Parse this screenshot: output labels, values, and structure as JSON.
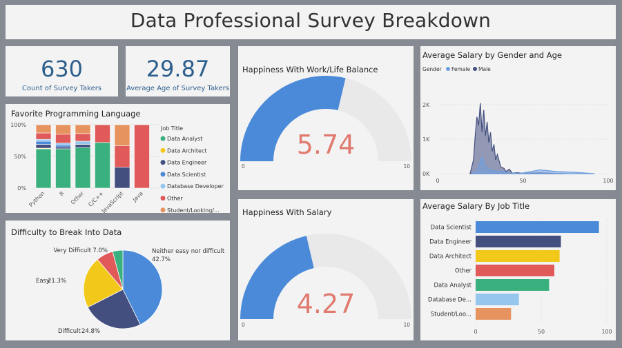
{
  "title": "Data Professional Survey Breakdown",
  "kpis": [
    {
      "value": "630",
      "label": "Count of Survey Takers"
    },
    {
      "value": "29.87",
      "label": "Average Age of Survey Takers"
    }
  ],
  "colors": {
    "Data Analyst": "#3bb07f",
    "Data Architect": "#f2c81a",
    "Data Engineer": "#434f7f",
    "Data Scientist": "#4d8ad8",
    "Database Developer": "#96c6ee",
    "Other": "#e05a5a",
    "Student/Looking/...": "#e6935f",
    "Gauge": "#4a8ad8",
    "Gauge Track": "#e9e9e9",
    "Gauge Value": "#e07a6f"
  },
  "chart_data": [
    {
      "type": "bar",
      "subtype": "100% stacked column",
      "title": "Favorite Programming Language",
      "categories": [
        "Python",
        "R",
        "Other",
        "C/C++",
        "JavaScript",
        "Java"
      ],
      "yticks": [
        "0%",
        "50%",
        "100%"
      ],
      "ylim": [
        0,
        100
      ],
      "legend_title": "Job Title",
      "legend": [
        "Data Analyst",
        "Data Architect",
        "Data Engineer",
        "Data Scientist",
        "Database Developer",
        "Other",
        "Student/Looking/..."
      ],
      "series": [
        {
          "name": "Data Analyst",
          "values": [
            62,
            62,
            64,
            72,
            0,
            0
          ]
        },
        {
          "name": "Data Architect",
          "values": [
            1,
            0,
            0,
            0,
            0,
            0
          ]
        },
        {
          "name": "Data Engineer",
          "values": [
            6,
            3,
            5,
            0,
            33,
            0
          ]
        },
        {
          "name": "Data Scientist",
          "values": [
            5,
            3,
            0,
            0,
            0,
            0
          ]
        },
        {
          "name": "Database Developer",
          "values": [
            3,
            3,
            5,
            0,
            0,
            0
          ]
        },
        {
          "name": "Other",
          "values": [
            10,
            14,
            12,
            28,
            34,
            100
          ]
        },
        {
          "name": "Student/Looking/...",
          "values": [
            13,
            15,
            14,
            0,
            33,
            0
          ]
        }
      ]
    },
    {
      "type": "pie",
      "title": "Difficulty to Break Into Data",
      "slices": [
        {
          "label": "Neither easy nor difficult",
          "value": 42.7,
          "display": "42.7%",
          "color": "#4a8ad8"
        },
        {
          "label": "Difficult",
          "value": 24.8,
          "display": "24.8%",
          "color": "#434f7f"
        },
        {
          "label": "Easy",
          "value": 21.3,
          "display": "21.3%",
          "color": "#f2c81a"
        },
        {
          "label": "Very Difficult",
          "value": 7.0,
          "display": "7.0%",
          "color": "#e05a5a"
        },
        {
          "label": "",
          "value": 4.2,
          "display": "",
          "color": "#3bb07f"
        }
      ]
    },
    {
      "type": "gauge",
      "title": "Happiness  With Work/Life Balance",
      "value": 5.74,
      "display": "5.74",
      "min": 0,
      "max": 10,
      "min_label": "0",
      "max_label": "10"
    },
    {
      "type": "gauge",
      "title": "Happiness With Salary",
      "value": 4.27,
      "display": "4.27",
      "min": 0,
      "max": 10,
      "min_label": "0",
      "max_label": "10"
    },
    {
      "type": "area",
      "title": "Average Salary by Gender and Age",
      "legend_title": "Gender",
      "xlim": [
        0,
        100
      ],
      "ylim": [
        0,
        2700
      ],
      "xticks": [
        0,
        50,
        100
      ],
      "xtick_labels": [
        "0",
        "50",
        "100"
      ],
      "yticks": [
        0,
        1000,
        2000
      ],
      "ytick_labels": [
        "0K",
        "1K",
        "2K"
      ],
      "series": [
        {
          "name": "Female",
          "color": "#6e9ee0",
          "x": [
            20,
            23,
            24,
            25,
            26,
            27,
            28,
            29,
            30,
            31,
            33,
            35,
            38,
            40,
            43,
            45,
            47,
            50,
            60,
            70,
            80,
            92
          ],
          "y": [
            0,
            100,
            200,
            350,
            480,
            380,
            220,
            180,
            150,
            90,
            100,
            60,
            80,
            40,
            0,
            30,
            0,
            20,
            110,
            60,
            40,
            0
          ]
        },
        {
          "name": "Male",
          "color": "#434f7f",
          "x": [
            19,
            21,
            22,
            23,
            24,
            25,
            26,
            27,
            28,
            29,
            30,
            31,
            32,
            33,
            34,
            35,
            37,
            39,
            40,
            42,
            44,
            46,
            50,
            60,
            70,
            75
          ],
          "y": [
            0,
            400,
            1100,
            1650,
            1400,
            2050,
            1200,
            1850,
            1100,
            1500,
            900,
            1200,
            650,
            850,
            400,
            560,
            200,
            150,
            60,
            130,
            0,
            30,
            10,
            20,
            5,
            0
          ]
        }
      ]
    },
    {
      "type": "bar",
      "subtype": "horizontal",
      "title": "Average Salary By Job Title",
      "categories": [
        "Data Scientist",
        "Data Engineer",
        "Data Architect",
        "Other",
        "Data Analyst",
        "Database De...",
        "Student/Loo..."
      ],
      "values": [
        94,
        65,
        64,
        60,
        56,
        33,
        27
      ],
      "colors": [
        "#4a8ad8",
        "#434f7f",
        "#f2c81a",
        "#e05a5a",
        "#3bb07f",
        "#96c6ee",
        "#e6935f"
      ],
      "xlim": [
        0,
        100
      ],
      "xticks": [
        "0",
        "50",
        "100"
      ]
    }
  ]
}
